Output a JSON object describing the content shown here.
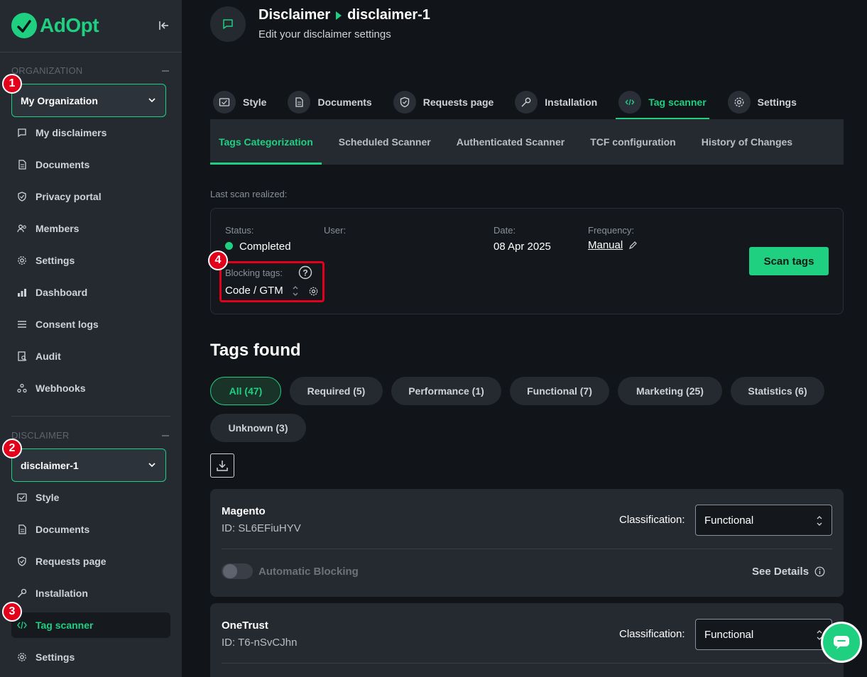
{
  "brand": {
    "name": "AdOpt",
    "accent": "#1ed080",
    "badge_color": "#e3001b"
  },
  "sidebar": {
    "org_section_label": "ORGANIZATION",
    "org_selector": "My Organization",
    "org_items": [
      {
        "label": "My disclaimers",
        "icon": "chat-icon"
      },
      {
        "label": "Documents",
        "icon": "document-icon"
      },
      {
        "label": "Privacy portal",
        "icon": "shield-icon"
      },
      {
        "label": "Members",
        "icon": "users-icon"
      },
      {
        "label": "Settings",
        "icon": "gear-icon"
      },
      {
        "label": "Dashboard",
        "icon": "bar-chart-icon"
      },
      {
        "label": "Consent logs",
        "icon": "list-icon"
      },
      {
        "label": "Audit",
        "icon": "audit-icon"
      },
      {
        "label": "Webhooks",
        "icon": "webhook-icon"
      }
    ],
    "disclaimer_section_label": "DISCLAIMER",
    "disclaimer_selector": "disclaimer-1",
    "disclaimer_items": [
      {
        "label": "Style",
        "icon": "style-icon"
      },
      {
        "label": "Documents",
        "icon": "document-icon"
      },
      {
        "label": "Requests page",
        "icon": "shield-icon"
      },
      {
        "label": "Installation",
        "icon": "key-icon"
      },
      {
        "label": "Tag scanner",
        "icon": "code-icon",
        "active": true
      },
      {
        "label": "Settings",
        "icon": "gear-icon"
      }
    ],
    "badges": [
      "1",
      "2",
      "3",
      "4"
    ]
  },
  "header": {
    "title": "Disclaimer",
    "subtitle_name": "disclaimer-1",
    "description": "Edit your disclaimer settings"
  },
  "tabs": [
    {
      "label": "Style",
      "icon": "style-icon"
    },
    {
      "label": "Documents",
      "icon": "document-icon"
    },
    {
      "label": "Requests page",
      "icon": "shield-icon"
    },
    {
      "label": "Installation",
      "icon": "key-icon"
    },
    {
      "label": "Tag scanner",
      "icon": "code-icon",
      "active": true
    },
    {
      "label": "Settings",
      "icon": "gear-icon"
    }
  ],
  "subtabs": [
    {
      "label": "Tags Categorization",
      "active": true
    },
    {
      "label": "Scheduled Scanner"
    },
    {
      "label": "Authenticated Scanner"
    },
    {
      "label": "TCF configuration"
    },
    {
      "label": "History of Changes"
    }
  ],
  "scan": {
    "last_scan_label": "Last scan realized:",
    "status_label": "Status:",
    "status_value": "Completed",
    "user_label": "User:",
    "date_label": "Date:",
    "date_value": "08 Apr 2025",
    "frequency_label": "Frequency:",
    "frequency_value": "Manual",
    "blocking_label": "Blocking tags:",
    "blocking_value": "Code / GTM",
    "scan_button": "Scan tags"
  },
  "tags_found": {
    "title": "Tags found",
    "filters": [
      {
        "label": "All (47)",
        "active": true
      },
      {
        "label": "Required (5)"
      },
      {
        "label": "Performance (1)"
      },
      {
        "label": "Functional (7)"
      },
      {
        "label": "Marketing (25)"
      },
      {
        "label": "Statistics (6)"
      },
      {
        "label": "Unknown (3)"
      }
    ],
    "items": [
      {
        "name": "Magento",
        "id": "ID: SL6EFiuHYV",
        "classification_label": "Classification:",
        "classification": "Functional",
        "auto_blocking_label": "Automatic Blocking",
        "see_details": "See Details"
      },
      {
        "name": "OneTrust",
        "id": "ID: T6-nSvCJhn",
        "classification_label": "Classification:",
        "classification": "Functional"
      }
    ]
  }
}
